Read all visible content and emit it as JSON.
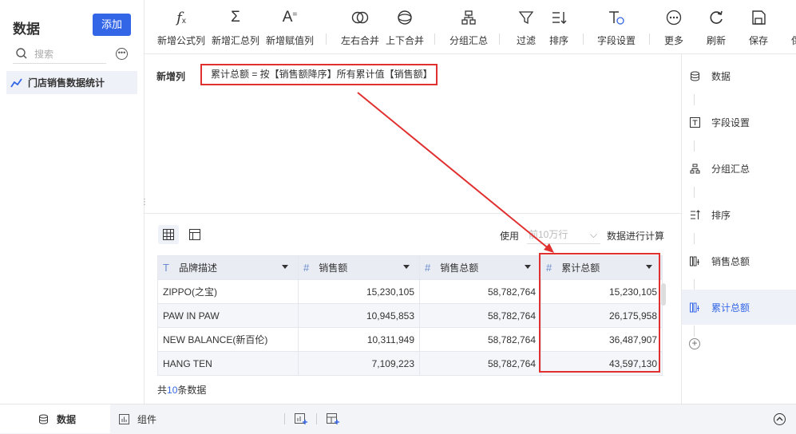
{
  "sidebar": {
    "title": "数据",
    "add_label": "添加",
    "search_placeholder": "搜索",
    "items": [
      {
        "label": "门店销售数据统计"
      }
    ]
  },
  "toolbar": {
    "items": [
      {
        "label": "新增公式列",
        "icon": "formula-icon"
      },
      {
        "label": "新增汇总列",
        "icon": "sum-icon"
      },
      {
        "label": "新增赋值列",
        "icon": "assign-icon"
      },
      {
        "label": "左右合并",
        "icon": "merge-horizontal-icon"
      },
      {
        "label": "上下合并",
        "icon": "merge-vertical-icon"
      },
      {
        "label": "分组汇总",
        "icon": "group-icon"
      },
      {
        "label": "过滤",
        "icon": "filter-icon"
      },
      {
        "label": "排序",
        "icon": "sort-icon"
      },
      {
        "label": "字段设置",
        "icon": "field-settings-icon"
      },
      {
        "label": "更多",
        "icon": "more-icon"
      },
      {
        "label": "刷新",
        "icon": "refresh-icon"
      },
      {
        "label": "保存",
        "icon": "save-icon"
      },
      {
        "label": "保",
        "icon": "save-as-icon"
      }
    ]
  },
  "formula": {
    "label": "新增列",
    "expression": "累计总额 = 按【销售额降序】所有累计值【销售额】"
  },
  "steps": [
    {
      "label": "数据",
      "icon": "database-icon"
    },
    {
      "label": "字段设置",
      "icon": "text-field-icon"
    },
    {
      "label": "分组汇总",
      "icon": "group-icon"
    },
    {
      "label": "排序",
      "icon": "sort-icon"
    },
    {
      "label": "销售总额",
      "icon": "column-icon"
    },
    {
      "label": "累计总额",
      "icon": "column-icon"
    }
  ],
  "preview": {
    "use_label": "使用",
    "use_placeholder": "前10万行",
    "use_suffix": "数据进行计算",
    "columns": [
      {
        "name": "品牌描述",
        "type": "T"
      },
      {
        "name": "销售额",
        "type": "#"
      },
      {
        "name": "销售总额",
        "type": "#"
      },
      {
        "name": "累计总额",
        "type": "#"
      }
    ],
    "rows": [
      [
        "ZIPPO(之宝)",
        "15,230,105",
        "58,782,764",
        "15,230,105"
      ],
      [
        "PAW IN PAW",
        "10,945,853",
        "58,782,764",
        "26,175,958"
      ],
      [
        "NEW BALANCE(新百伦)",
        "10,311,949",
        "58,782,764",
        "36,487,907"
      ],
      [
        "HANG TEN",
        "7,109,223",
        "58,782,764",
        "43,597,130"
      ]
    ],
    "count_prefix": "共",
    "count": "10",
    "count_suffix": "条数据"
  },
  "bottom": {
    "tabs": [
      {
        "label": "数据"
      },
      {
        "label": "组件"
      }
    ]
  },
  "colors": {
    "accent": "#3366e6",
    "highlight": "#e03030"
  }
}
